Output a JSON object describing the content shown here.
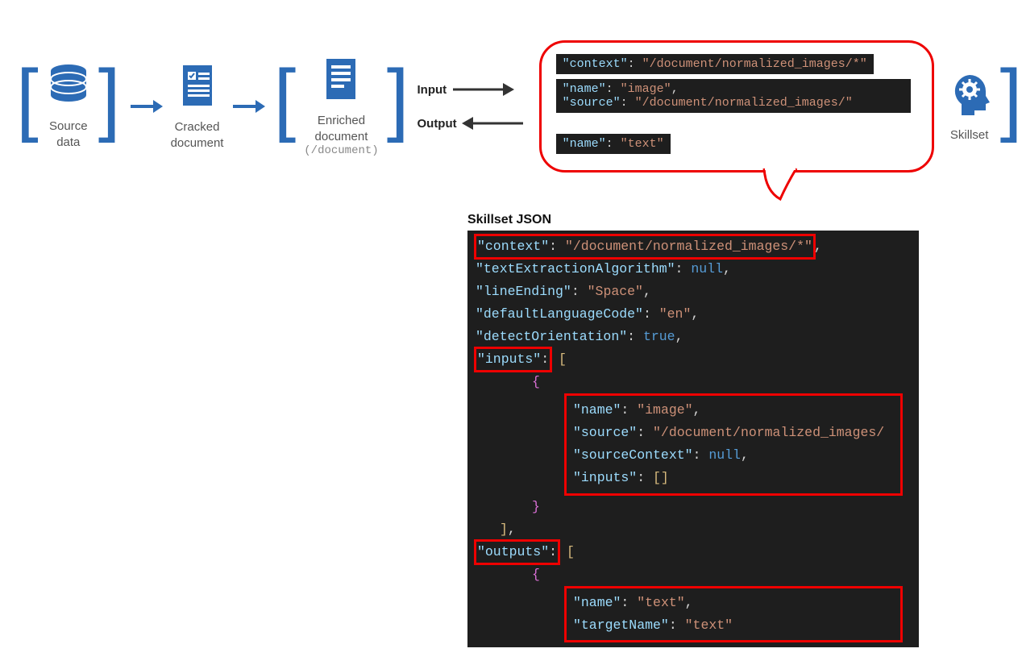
{
  "stages": {
    "source": "Source\ndata",
    "cracked": "Cracked\ndocument",
    "enriched": "Enriched\ndocument",
    "enriched_sub": "(/document)",
    "skillset": "Skillset"
  },
  "io": {
    "input_label": "Input",
    "output_label": "Output"
  },
  "bubble": {
    "line1_key": "\"context\"",
    "line1_val": "\"/document/normalized_images/*\"",
    "line2_key1": "\"name\"",
    "line2_val1": "\"image\"",
    "line2_key2": "\"source\"",
    "line2_val2": "\"/document/normalized_images/\"",
    "line3_key": "\"name\"",
    "line3_val": "\"text\""
  },
  "json_title": "Skillset JSON",
  "json": {
    "context_k": "\"context\"",
    "context_v": "\"/document/normalized_images/*\"",
    "tea_k": "\"textExtractionAlgorithm\"",
    "tea_v": "null",
    "lineEnding_k": "\"lineEnding\"",
    "lineEnding_v": "\"Space\"",
    "lang_k": "\"defaultLanguageCode\"",
    "lang_v": "\"en\"",
    "detect_k": "\"detectOrientation\"",
    "detect_v": "true",
    "inputs_k": "\"inputs\"",
    "in_name_k": "\"name\"",
    "in_name_v": "\"image\"",
    "in_source_k": "\"source\"",
    "in_source_v": "\"/document/normalized_images/",
    "in_sc_k": "\"sourceContext\"",
    "in_sc_v": "null",
    "in_inputs_k": "\"inputs\"",
    "outputs_k": "\"outputs\"",
    "out_name_k": "\"name\"",
    "out_name_v": "\"text\"",
    "out_target_k": "\"targetName\"",
    "out_target_v": "\"text\""
  }
}
